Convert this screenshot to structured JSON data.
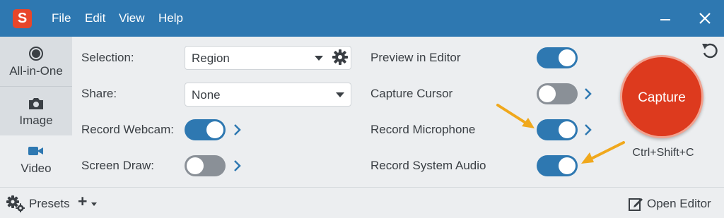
{
  "titlebar": {
    "logo_letter": "S",
    "menu": [
      "File",
      "Edit",
      "View",
      "Help"
    ]
  },
  "modes": {
    "all_in_one": "All-in-One",
    "image": "Image",
    "video": "Video",
    "selected": "Video"
  },
  "settings": {
    "selection_label": "Selection:",
    "selection_value": "Region",
    "share_label": "Share:",
    "share_value": "None",
    "webcam_label": "Record Webcam:",
    "webcam_on": true,
    "screen_draw_label": "Screen Draw:",
    "screen_draw_on": false,
    "preview_label": "Preview in Editor",
    "preview_on": true,
    "cursor_label": "Capture Cursor",
    "cursor_on": false,
    "microphone_label": "Record Microphone",
    "microphone_on": true,
    "system_audio_label": "Record System Audio",
    "system_audio_on": true
  },
  "capture": {
    "label": "Capture",
    "shortcut": "Ctrl+Shift+C"
  },
  "bottom": {
    "presets_label": "Presets",
    "add_label": "+",
    "open_editor_label": "Open Editor"
  },
  "colors": {
    "titlebar": "#2e78b1",
    "toggle_on": "#2e78b1",
    "toggle_off": "#8a9097",
    "capture": "#dd3a1e",
    "annotation_arrow": "#f0a81c"
  },
  "icons": {
    "logo": "snagit-logo-icon",
    "minimize": "minimize-icon",
    "close": "close-icon",
    "reset": "reset-icon",
    "all_in_one": "record-dot-icon",
    "image": "camera-icon",
    "video": "video-camera-icon",
    "settings": "gear-icon",
    "presets": "gear-icon",
    "open_editor": "edit-icon"
  }
}
